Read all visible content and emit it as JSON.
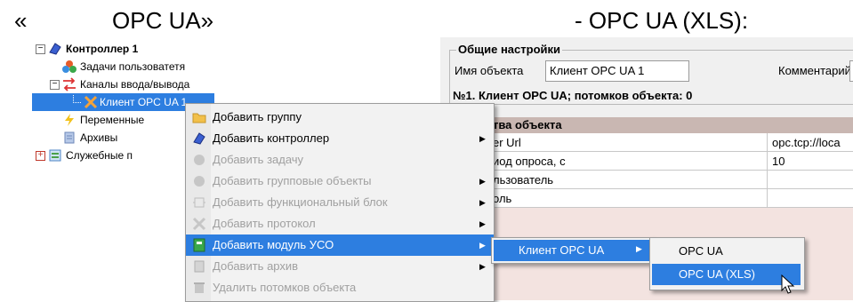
{
  "captions": {
    "left_quote": "«",
    "left_text": "OPC UA»",
    "right_text": "- OPC UA (XLS):"
  },
  "tree": {
    "items": [
      {
        "label": "Контроллер 1",
        "icon": "controller-icon"
      },
      {
        "label": "Задачи пользоватетя",
        "icon": "tasks-icon"
      },
      {
        "label": "Каналы ввода/вывода",
        "icon": "io-channels-icon"
      },
      {
        "label": "Клиент OPC UA 1",
        "icon": "opc-client-icon"
      },
      {
        "label": "Переменные",
        "icon": "variables-icon"
      },
      {
        "label": "Архивы",
        "icon": "archives-icon"
      },
      {
        "label": "Служебные п",
        "icon": "service-icon"
      }
    ]
  },
  "panel": {
    "general_settings": "Общие настройки",
    "object_name_label": "Имя объекта",
    "object_name_value": "Клиент OPC UA 1",
    "comment_label": "Комментарий",
    "info_line": "№1. Клиент OPC UA; потомков объекта: 0",
    "properties_header": "тва объекта",
    "properties": [
      {
        "name": "er Url",
        "value": "opc.tcp://loca"
      },
      {
        "name": "иод опроса, с",
        "value": "10"
      },
      {
        "name": "льзователь",
        "value": ""
      },
      {
        "name": "оль",
        "value": ""
      }
    ]
  },
  "context_menu": {
    "items": [
      {
        "label": "Добавить группу",
        "icon": "folder-icon",
        "disabled": false,
        "submenu": false
      },
      {
        "label": "Добавить контроллер",
        "icon": "controller-icon",
        "disabled": false,
        "submenu": true
      },
      {
        "label": "Добавить задачу",
        "icon": "task-icon",
        "disabled": true,
        "submenu": false
      },
      {
        "label": "Добавить групповые объекты",
        "icon": "group-objects-icon",
        "disabled": true,
        "submenu": true
      },
      {
        "label": "Добавить функциональный блок",
        "icon": "function-block-icon",
        "disabled": true,
        "submenu": true
      },
      {
        "label": "Добавить протокол",
        "icon": "protocol-icon",
        "disabled": true,
        "submenu": true
      },
      {
        "label": "Добавить модуль УСО",
        "icon": "io-module-icon",
        "disabled": false,
        "submenu": true,
        "highlighted": true
      },
      {
        "label": "Добавить архив",
        "icon": "archive-icon",
        "disabled": true,
        "submenu": true
      },
      {
        "label": "Удалить потомков объекта",
        "icon": "delete-children-icon",
        "disabled": true,
        "submenu": false
      }
    ]
  },
  "submenu": {
    "item": "Клиент OPC UA"
  },
  "submenu2": {
    "items": [
      "OPC UA",
      "OPC UA (XLS)"
    ]
  },
  "colors": {
    "selection": "#2d7ee0",
    "grid_header": "#c9b7b2",
    "menu_bg": "#f2f2f2"
  }
}
